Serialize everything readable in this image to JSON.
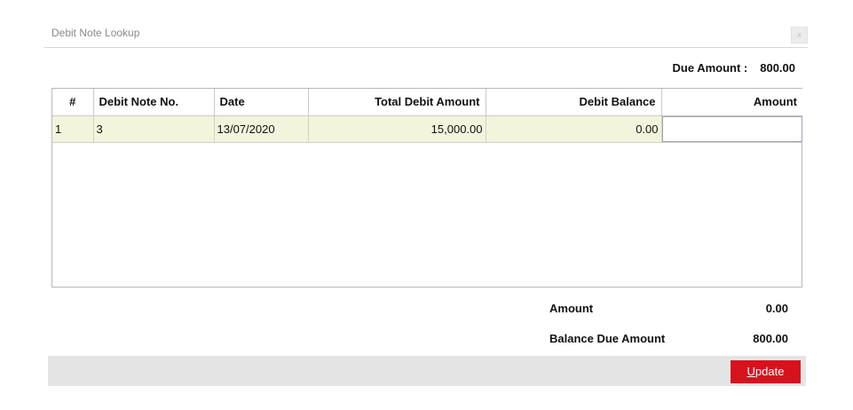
{
  "dialog": {
    "title": "Debit Note Lookup",
    "close_glyph": "x"
  },
  "due_amount": {
    "label": "Due Amount :",
    "value": "800.00"
  },
  "grid": {
    "columns": [
      "#",
      "Debit Note No.",
      "Date",
      "Total Debit Amount",
      "Debit Balance",
      "Amount"
    ],
    "rows": [
      {
        "index": "1",
        "debit_note_no": "3",
        "date": "13/07/2020",
        "total_debit_amount": "15,000.00",
        "debit_balance": "0.00",
        "amount": ""
      }
    ]
  },
  "summary": {
    "amount_label": "Amount",
    "amount_value": "0.00",
    "balance_due_label": "Balance Due Amount",
    "balance_due_value": "800.00"
  },
  "footer": {
    "update_accel": "U",
    "update_rest": "pdate"
  },
  "colors": {
    "row_background": "#f3f4dc",
    "update_button": "#d7121f",
    "footer_bar": "#e5e5e5"
  }
}
